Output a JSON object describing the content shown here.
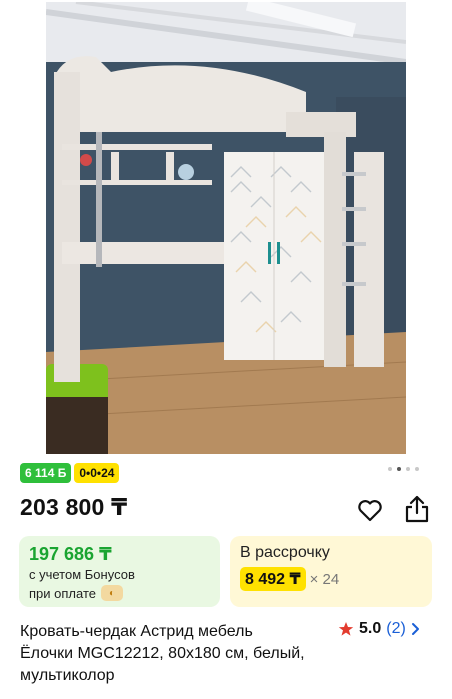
{
  "product": {
    "image_alt": "Кровать-чердак Астрид мебель",
    "badges": {
      "bonus": "6 114 Б",
      "split": "0•0•24"
    },
    "gallery_dots": 4,
    "gallery_active": 1,
    "price": "203 800 ₸",
    "bonus_card": {
      "value": "197 686 ₸",
      "line1": "с учетом Бонусов",
      "line2": "при оплате"
    },
    "installment_card": {
      "title": "В рассрочку",
      "amount": "8 492 ₸",
      "multiplier": "× 24"
    },
    "title": "Кровать-чердак Астрид мебель Ёлочки MGC12212, 80x180 см, белый, мультиколор",
    "rating": {
      "score": "5.0",
      "count": "(2)"
    }
  },
  "colors": {
    "bonus_green": "#2fbf3b",
    "split_yellow": "#ffe100",
    "bonus_card_bg": "#e9f8e2",
    "installment_card_bg": "#fff8d6",
    "star": "#e33b2e",
    "link_blue": "#1a5fd6"
  },
  "icons": [
    "heart-icon",
    "share-icon",
    "star-icon",
    "chevron-right-icon",
    "bonus-coin-icon"
  ]
}
